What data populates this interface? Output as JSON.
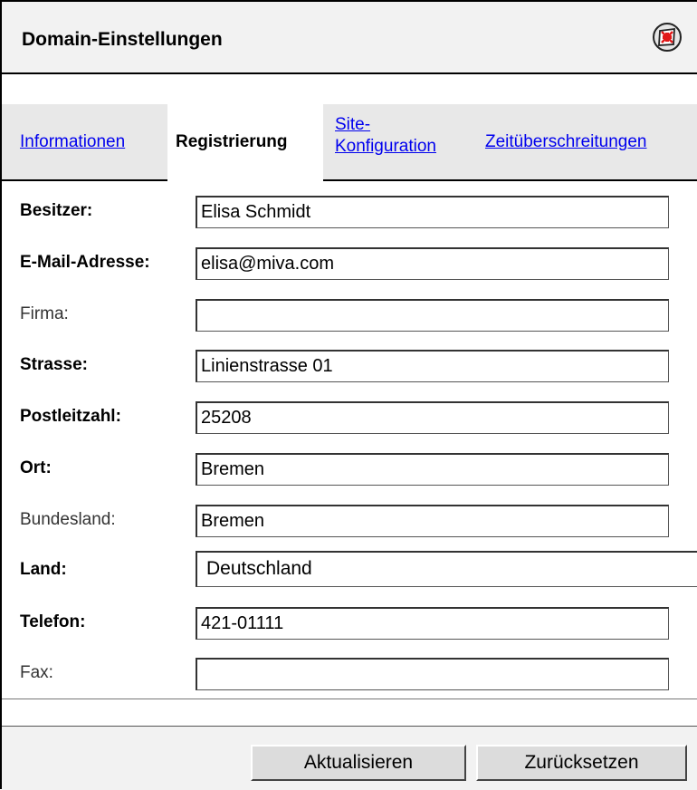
{
  "window": {
    "title": "Domain-Einstellungen"
  },
  "tabs": [
    {
      "label": "Informationen",
      "active": false
    },
    {
      "label": "Registrierung",
      "active": true
    },
    {
      "label_line1": "Site-",
      "label_line2": "Konfiguration",
      "active": false
    },
    {
      "label": "Zeitüberschreitungen",
      "active": false
    }
  ],
  "form": {
    "owner": {
      "label": "Besitzer:",
      "value": "Elisa Schmidt"
    },
    "email": {
      "label": "E-Mail-Adresse:",
      "value": "elisa@miva.com"
    },
    "company": {
      "label": "Firma:",
      "value": ""
    },
    "street": {
      "label": "Strasse:",
      "value": "Linienstrasse 01"
    },
    "zip": {
      "label": "Postleitzahl:",
      "value": "25208"
    },
    "city": {
      "label": "Ort:",
      "value": "Bremen"
    },
    "state": {
      "label": "Bundesland:",
      "value": "Bremen"
    },
    "country": {
      "label": "Land:",
      "value": "Deutschland"
    },
    "phone": {
      "label": "Telefon:",
      "value": "421-01111"
    },
    "fax": {
      "label": "Fax:",
      "value": ""
    }
  },
  "buttons": {
    "update": "Aktualisieren",
    "reset": "Zurücksetzen"
  },
  "colors": {
    "link": "#0000ee",
    "tab_bg": "#e8e8e8",
    "header_bg": "#f2f2f2",
    "close_icon_red": "#e01818"
  }
}
